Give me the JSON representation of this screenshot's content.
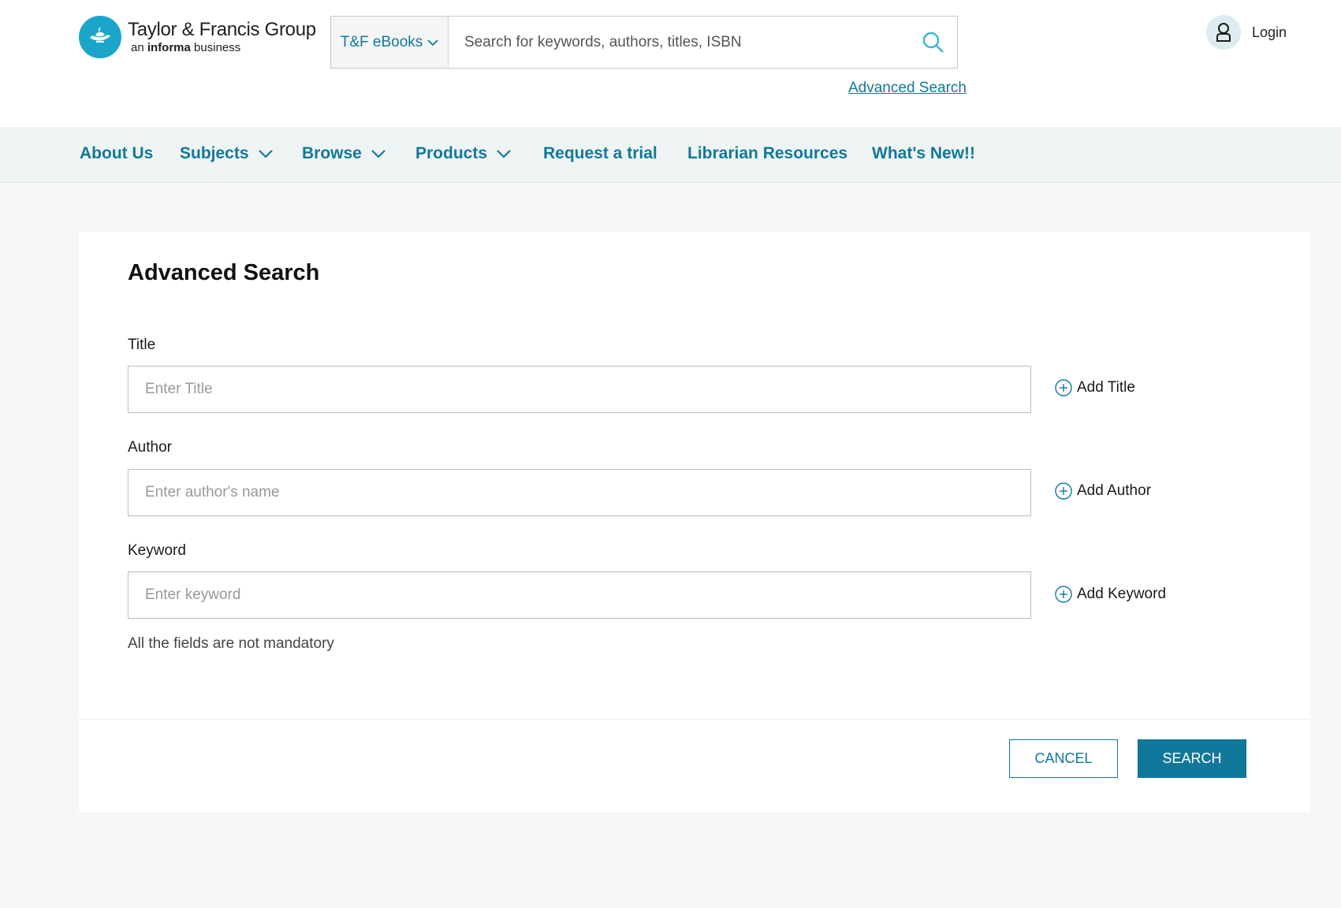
{
  "brand": {
    "name": "Taylor & Francis Group",
    "tagline_prefix": "an",
    "tagline_bold": "informa",
    "tagline_suffix": "business",
    "color": "#1ba6c9"
  },
  "search": {
    "scope_label": "T&F eBooks",
    "placeholder": "Search for keywords, authors, titles, ISBN",
    "advanced_link": "Advanced Search"
  },
  "user": {
    "login_label": "Login"
  },
  "nav": {
    "items": [
      {
        "label": "About Us",
        "dropdown": false
      },
      {
        "label": "Subjects",
        "dropdown": true
      },
      {
        "label": "Browse",
        "dropdown": true
      },
      {
        "label": "Products",
        "dropdown": true
      },
      {
        "label": "Request a trial",
        "dropdown": false
      },
      {
        "label": "Librarian Resources",
        "dropdown": false
      },
      {
        "label": "What's New!!",
        "dropdown": false
      }
    ]
  },
  "form": {
    "title": "Advanced Search",
    "fields": [
      {
        "label": "Title",
        "placeholder": "Enter Title",
        "add_label": "Add Title"
      },
      {
        "label": "Author",
        "placeholder": "Enter author's name",
        "add_label": "Add Author"
      },
      {
        "label": "Keyword",
        "placeholder": "Enter keyword",
        "add_label": "Add Keyword"
      }
    ],
    "note": "All the fields are not mandatory",
    "cancel_label": "CANCEL",
    "search_label": "SEARCH"
  },
  "colors": {
    "accent": "#12789b",
    "nav_bg": "#eef4f4",
    "page_bg": "#f6f7f7"
  }
}
